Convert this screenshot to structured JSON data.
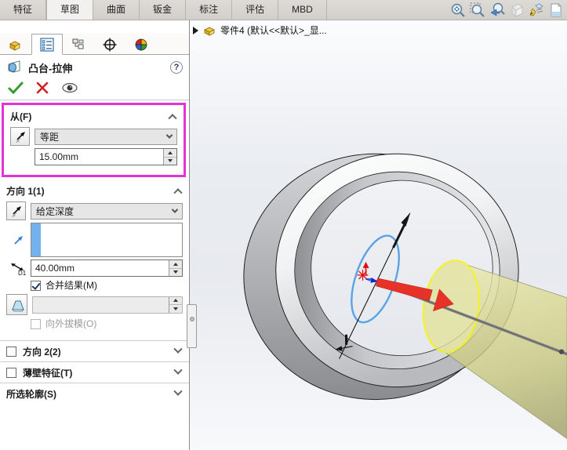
{
  "ribbon": {
    "tabs": [
      {
        "label": "特征"
      },
      {
        "label": "草图"
      },
      {
        "label": "曲面"
      },
      {
        "label": "钣金"
      },
      {
        "label": "标注"
      },
      {
        "label": "评估"
      },
      {
        "label": "MBD"
      }
    ]
  },
  "headsup_icons": [
    "zoom-fit",
    "zoom-area",
    "previous-view",
    "section-view",
    "view-settings",
    "edit-appearance"
  ],
  "viewport": {
    "title": "零件4 (默认<<默认>_显..."
  },
  "panel": {
    "tabs": [
      "featuremanager",
      "propertymanager",
      "configurationmanager",
      "dimxpertmanager",
      "displaymanager"
    ],
    "header": {
      "title": "凸台-拉伸",
      "help": "?"
    },
    "from_group": {
      "label": "从(F)",
      "condition": "等距",
      "offset_value": "15.00mm"
    },
    "direction1_group": {
      "label": "方向 1(1)",
      "condition": "给定深度",
      "depth_value": "40.00mm",
      "d1_label": "D1",
      "merge_label": "合并结果(M)",
      "draft_value": "",
      "draft_outward_label": "向外拔模(O)"
    },
    "direction2_group": {
      "label": "方向 2(2)"
    },
    "thin_feature_group": {
      "label": "薄壁特征(T)"
    },
    "selected_contours_group": {
      "label": "所选轮廓(S)"
    }
  },
  "colors": {
    "highlight_magenta": "#e332d8",
    "selection_blue": "#74b2ed",
    "arrow_red": "#e63227",
    "preview_yellow": "#d9d98f",
    "sketch_blue": "#5aa2e6"
  }
}
